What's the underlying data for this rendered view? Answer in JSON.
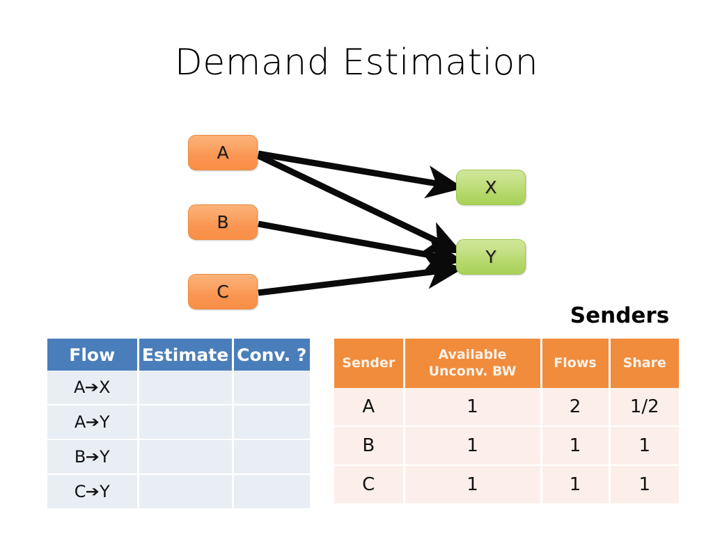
{
  "slide": {
    "title": "Demand Estimation",
    "background_color": "#ffffff"
  },
  "diagram": {
    "senders_caption": "Senders",
    "sender_nodes": [
      {
        "label": "A",
        "color": "#fa9551"
      },
      {
        "label": "B",
        "color": "#fa9551"
      },
      {
        "label": "C",
        "color": "#fa9551"
      }
    ],
    "receiver_nodes": [
      {
        "label": "X",
        "color": "#b4d86a"
      },
      {
        "label": "Y",
        "color": "#b4d86a"
      }
    ],
    "edges": [
      {
        "from": "A",
        "to": "X"
      },
      {
        "from": "A",
        "to": "Y"
      },
      {
        "from": "B",
        "to": "Y"
      },
      {
        "from": "C",
        "to": "Y"
      }
    ]
  },
  "flows_table": {
    "header_color": "#4a7ebb",
    "row_color": "#e9edf4",
    "columns": [
      "Flow",
      "Estimate",
      "Conv. ?"
    ],
    "rows": [
      {
        "flow_from": "A",
        "flow_arrow": "➔",
        "flow_to": "X",
        "estimate": "",
        "conv": ""
      },
      {
        "flow_from": "A",
        "flow_arrow": "➔",
        "flow_to": "Y",
        "estimate": "",
        "conv": ""
      },
      {
        "flow_from": "B",
        "flow_arrow": "➔",
        "flow_to": "Y",
        "estimate": "",
        "conv": ""
      },
      {
        "flow_from": "C",
        "flow_arrow": "➔",
        "flow_to": "Y",
        "estimate": "",
        "conv": ""
      }
    ]
  },
  "senders_table": {
    "header_color": "#f08c3c",
    "row_color": "#fcefe9",
    "columns": [
      "Sender",
      "Available Unconv. BW",
      "Flows",
      "Share"
    ],
    "column_line1": [
      "Sender",
      "Available",
      "Flows",
      "Share"
    ],
    "column_line2": [
      "",
      "Unconv. BW",
      "",
      ""
    ],
    "rows": [
      {
        "sender": "A",
        "available_unconv_bw": "1",
        "flows": "2",
        "share": "1/2"
      },
      {
        "sender": "B",
        "available_unconv_bw": "1",
        "flows": "1",
        "share": "1"
      },
      {
        "sender": "C",
        "available_unconv_bw": "1",
        "flows": "1",
        "share": "1"
      }
    ]
  }
}
